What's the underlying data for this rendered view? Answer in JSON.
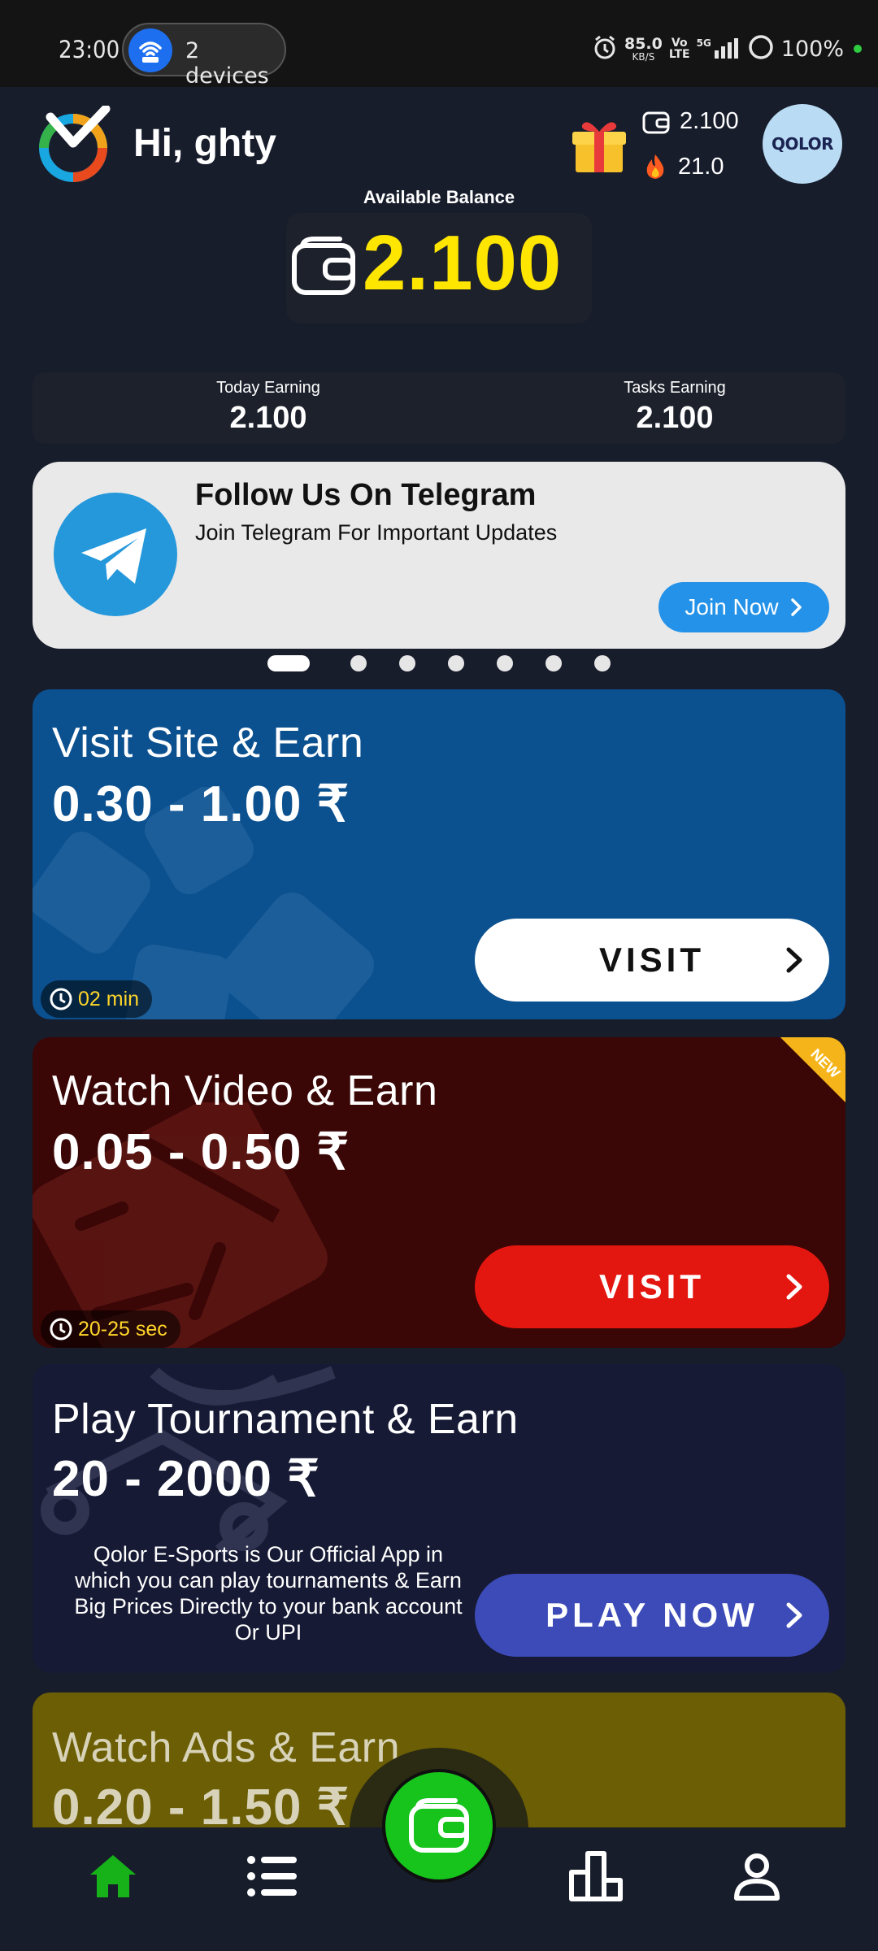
{
  "status_bar": {
    "time": "23:00",
    "hotspot_label": "2 devices",
    "speed_value": "85.0",
    "speed_unit": "KB/S",
    "volte_top": "Vo",
    "volte_bottom": "LTE",
    "network": "5G",
    "battery": "100%"
  },
  "header": {
    "greeting": "Hi, ghty",
    "wallet_balance": "2.100",
    "streak": "21.0",
    "avatar_text": "QOLOR"
  },
  "balance": {
    "label": "Available Balance",
    "value": "2.100"
  },
  "earnings": {
    "today_label": "Today Earning",
    "today_value": "2.100",
    "tasks_label": "Tasks Earning",
    "tasks_value": "2.100"
  },
  "banner": {
    "title": "Follow Us On Telegram",
    "subtitle": "Join Telegram For Important Updates",
    "button": "Join Now",
    "slide_count": 7,
    "active_slide": 1
  },
  "tasks": [
    {
      "title": "Visit Site & Earn",
      "range": "0.30 - 1.00 ₹",
      "button": "VISIT",
      "timer": "02 min"
    },
    {
      "title": "Watch Video & Earn",
      "range": "0.05 - 0.50  ₹",
      "button": "VISIT",
      "timer": "20-25 sec",
      "badge": "NEW"
    },
    {
      "title": "Play Tournament & Earn",
      "range": "20 - 2000 ₹",
      "description": "Qolor E-Sports is Our Official App in which you can play tournaments & Earn Big Prices Directly to your bank account Or UPI",
      "button": "PLAY NOW"
    },
    {
      "title": "Watch Ads & Earn",
      "range": "0.20 - 1.50 ₹"
    }
  ],
  "nav": {
    "items": [
      "home-icon",
      "list-icon",
      "wallet-icon",
      "leaderboard-icon",
      "profile-icon"
    ],
    "active": "home-icon",
    "active_color": "#17b21a"
  }
}
